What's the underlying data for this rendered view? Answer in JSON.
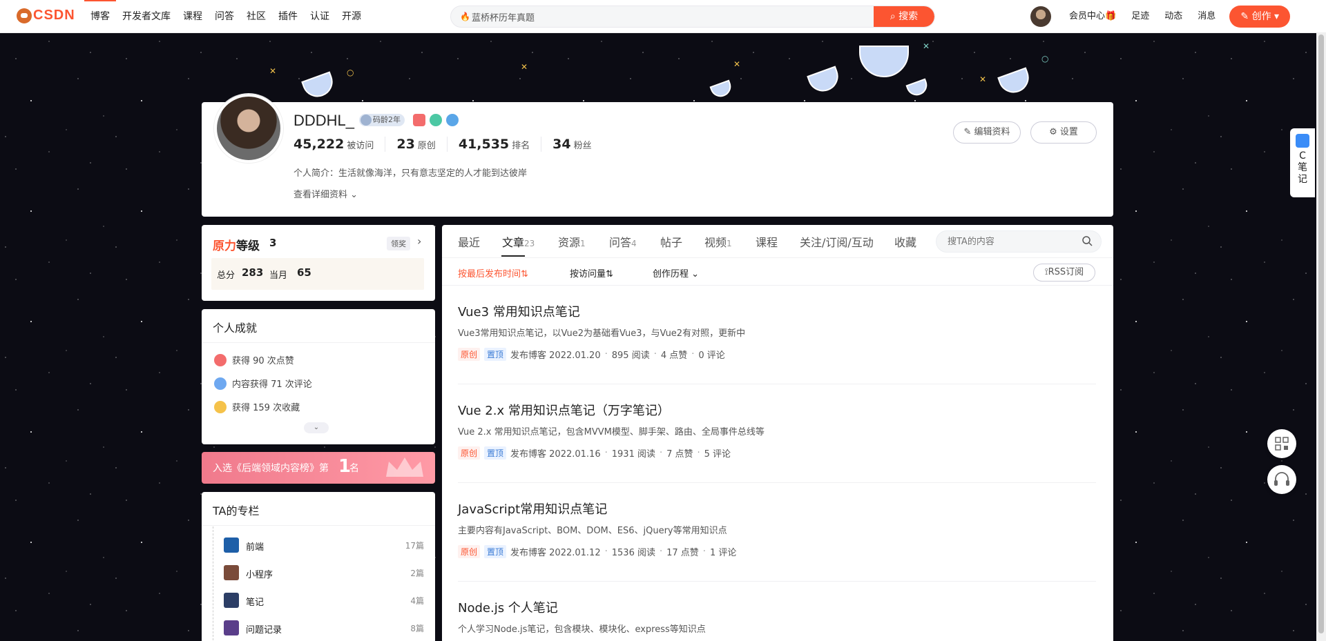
{
  "header": {
    "logo_text": "CSDN",
    "nav": [
      "博客",
      "开发者文库",
      "课程",
      "问答",
      "社区",
      "插件",
      "认证",
      "开源"
    ],
    "search_value": "蓝桥杯历年真题",
    "search_button": "搜索",
    "links": [
      "会员中心",
      "足迹",
      "动态",
      "消息"
    ],
    "create_button": "创作"
  },
  "profile": {
    "name": "DDDHL_",
    "badge_age": "码龄2年",
    "stats": [
      {
        "value": "45,222",
        "label": "被访问"
      },
      {
        "value": "23",
        "label": "原创"
      },
      {
        "value": "41,535",
        "label": "排名"
      },
      {
        "value": "34",
        "label": "粉丝"
      }
    ],
    "intro": "个人简介：生活就像海洋，只有意志坚定的人才能到达彼岸",
    "more": "查看详细资料",
    "edit_button": "编辑资料",
    "settings_button": "设置"
  },
  "level": {
    "title_a": "原力",
    "title_b": "等级",
    "level": "3",
    "reward": "领奖",
    "total_label": "总分",
    "total": "283",
    "month_label": "当月",
    "month": "65"
  },
  "achievements": {
    "title": "个人成就",
    "items": [
      "获得 90 次点赞",
      "内容获得 71 次评论",
      "获得 159 次收藏"
    ]
  },
  "rank_banner": {
    "text": "入选《后端领域内容榜》第",
    "number": "1",
    "suffix": "名"
  },
  "columns": {
    "title": "TA的专栏",
    "items": [
      {
        "name": "前端",
        "count": "17篇"
      },
      {
        "name": "小程序",
        "count": "2篇"
      },
      {
        "name": "笔记",
        "count": "4篇"
      },
      {
        "name": "问题记录",
        "count": "8篇"
      }
    ]
  },
  "tabs": {
    "items": [
      {
        "label": "最近",
        "count": ""
      },
      {
        "label": "文章",
        "count": "23"
      },
      {
        "label": "资源",
        "count": "1"
      },
      {
        "label": "问答",
        "count": "4"
      },
      {
        "label": "帖子",
        "count": ""
      },
      {
        "label": "视频",
        "count": "1"
      },
      {
        "label": "课程",
        "count": ""
      },
      {
        "label": "关注/订阅/互动",
        "count": ""
      },
      {
        "label": "收藏",
        "count": ""
      }
    ],
    "search_placeholder": "搜TA的内容"
  },
  "sort": {
    "by_time": "按最后发布时间⇅",
    "by_views": "按访问量⇅",
    "history": "创作历程",
    "rss": "RSS订阅"
  },
  "articles": [
    {
      "title": "Vue3 常用知识点笔记",
      "desc": "Vue3常用知识点笔记，以Vue2为基础看Vue3，与Vue2有对照，更新中",
      "tag1": "原创",
      "tag2": "置顶",
      "date": "发布博客 2022.01.20",
      "reads": "895 阅读",
      "likes": "4 点赞",
      "comments": "0 评论"
    },
    {
      "title": "Vue 2.x 常用知识点笔记（万字笔记）",
      "desc": "Vue 2.x 常用知识点笔记，包含MVVM模型、脚手架、路由、全局事件总线等",
      "tag1": "原创",
      "tag2": "置顶",
      "date": "发布博客 2022.01.16",
      "reads": "1931 阅读",
      "likes": "7 点赞",
      "comments": "5 评论"
    },
    {
      "title": "JavaScript常用知识点笔记",
      "desc": "主要内容有JavaScript、BOM、DOM、ES6、jQuery等常用知识点",
      "tag1": "原创",
      "tag2": "置顶",
      "date": "发布博客 2022.01.12",
      "reads": "1536 阅读",
      "likes": "17 点赞",
      "comments": "1 评论"
    },
    {
      "title": "Node.js 个人笔记",
      "desc": "个人学习Node.js笔记，包含模块、模块化、express等知识点"
    }
  ],
  "side_note": "C笔记",
  "colors": {
    "brand": "#fc5531"
  }
}
